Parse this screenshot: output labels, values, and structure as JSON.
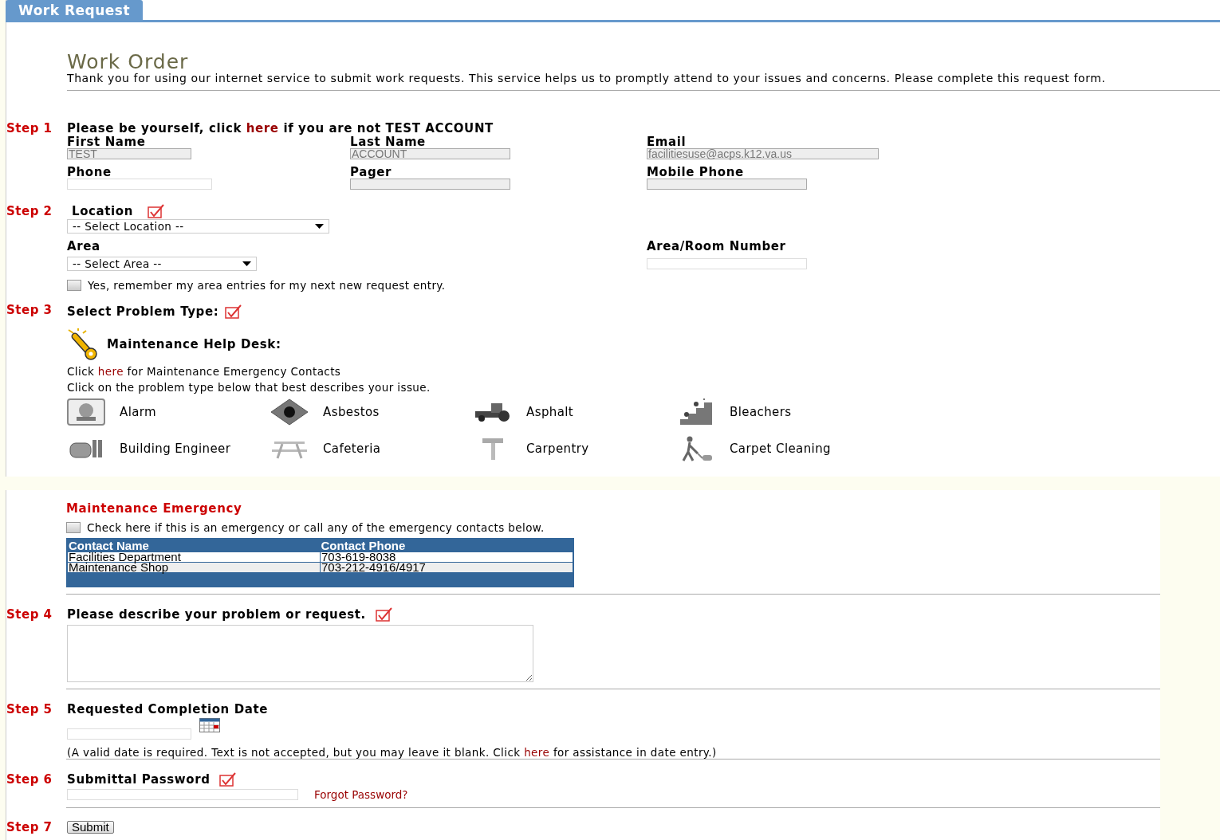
{
  "tab": {
    "label": "Work Request",
    "selected": true
  },
  "title": "Work Order",
  "intro": "Thank you for using our internet service to submit work requests. This service helps us to promptly attend to your issues and concerns. Please complete this request form.",
  "step1": {
    "label": "Step 1",
    "before": "Please be yourself, click ",
    "link": "here",
    "after": " if you are not TEST ACCOUNT",
    "fields": [
      {
        "label": "First Name",
        "value": "TEST",
        "disabled": true
      },
      {
        "label": "Last Name",
        "value": "ACCOUNT",
        "disabled": true
      },
      {
        "label": "Email",
        "value": "facilitiesuse@acps.k12.va.us",
        "disabled": true
      },
      {
        "label": "Phone",
        "disabled": false
      },
      {
        "label": "Pager",
        "disabled": true
      },
      {
        "label": "Mobile Phone",
        "disabled": true
      }
    ]
  },
  "step2": {
    "label": "Step 2",
    "heading": "Location",
    "required": true,
    "location_select": "-- Select Location --",
    "area_label": "Area",
    "area_select": "-- Select Area --",
    "room_label": "Area/Room Number",
    "remember": {
      "label": "Yes, remember my area entries for my next new request entry.",
      "checked": false
    }
  },
  "step3": {
    "label": "Step 3",
    "heading": "Select Problem Type:",
    "required": true,
    "help_desk": "Maintenance Help Desk:",
    "contacts_before": "Click ",
    "contacts_link": "here",
    "contacts_after": " for Maintenance Emergency Contacts",
    "instruction": "Click on the problem type below that best describes your issue.",
    "problem_types": [
      "Alarm",
      "Asbestos",
      "Asphalt",
      "Bleachers",
      "Building Engineer",
      "Cafeteria",
      "Carpentry",
      "Carpet Cleaning"
    ]
  },
  "emergency": {
    "title": "Maintenance Emergency",
    "checkbox": {
      "label": "Check here if this is an emergency or call any of the emergency contacts below.",
      "checked": false
    },
    "columns": [
      "Contact Name",
      "Contact Phone"
    ],
    "rows": [
      [
        "Facilities Department",
        "703-619-8038"
      ],
      [
        "Maintenance Shop",
        "703-212-4916/4917"
      ]
    ]
  },
  "step4": {
    "label": "Step 4",
    "heading": "Please describe your problem or request.",
    "required": true
  },
  "step5": {
    "label": "Step 5",
    "heading": "Requested Completion Date",
    "note_before": "(A valid date is required. Text is not accepted, but you may leave it blank. Click ",
    "note_link": "here",
    "note_after": " for assistance in date entry.)"
  },
  "step6": {
    "label": "Step 6",
    "heading": "Submittal Password",
    "required": true,
    "forgot": "Forgot Password?"
  },
  "step7": {
    "label": "Step 7",
    "button": "Submit"
  }
}
